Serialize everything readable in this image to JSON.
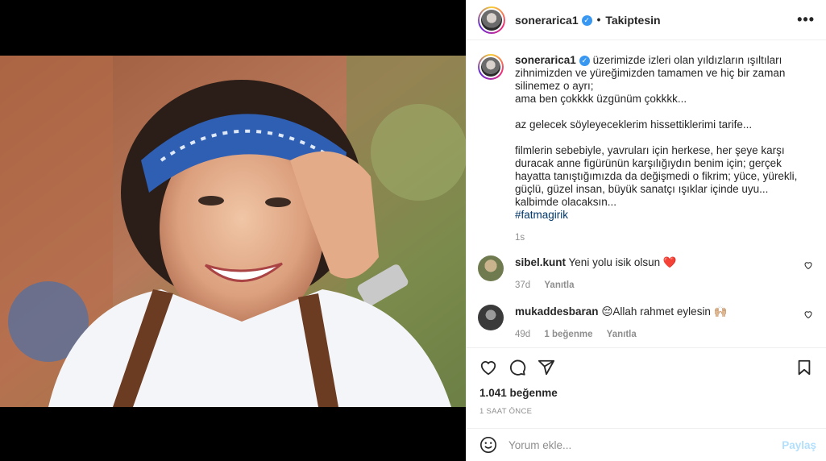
{
  "post": {
    "username": "sonerarica1",
    "follow_status": "Takiptesin",
    "separator": "•",
    "more_icon": "more-horizontal-icon"
  },
  "caption": {
    "username": "sonerarica1",
    "text": "üzerimizde izleri olan yıldızların ışıltıları zihnimizden ve yüreğimizden tamamen ve hiç bir zaman silinemez o ayrı;\nama ben çokkkk üzgünüm çokkkk...\n\naz gelecek söyleyeceklerim hissettiklerimi tarife...\n\nfilmlerin sebebiyle, yavruları için herkese, her şeye karşı duracak anne figürünün karşılığıydın benim için; gerçek hayatta tanıştığımızda da değişmedi o fikrim; yüce, yürekli, güçlü, güzel insan, büyük sanatçı ışıklar içinde uyu... kalbimde olacaksın...",
    "hashtag": "#fatmagirik",
    "age": "1s"
  },
  "comments": [
    {
      "username": "sibel.kunt",
      "text": "Yeni yolu isik olsun ❤️",
      "age": "37d",
      "likes": "",
      "reply_label": "Yanıtla",
      "avatar_color": "#6f7a4f"
    },
    {
      "username": "mukaddesbaran",
      "text": "😔Allah rahmet eylesin 🙌🏼",
      "age": "49d",
      "likes": "1 beğenme",
      "reply_label": "Yanıtla",
      "avatar_color": "#3a3a3a"
    }
  ],
  "actions": {
    "like_icon": "heart-icon",
    "comment_icon": "comment-icon",
    "share_icon": "share-icon",
    "save_icon": "bookmark-icon",
    "likes_count": "1.041 beğenme",
    "timestamp": "1 SAAT ÖNCE"
  },
  "add_comment": {
    "placeholder": "Yorum ekle...",
    "post_label": "Paylaş",
    "emoji_icon": "emoji-icon"
  },
  "colors": {
    "verified": "#3897f0",
    "link": "#00376b",
    "post_disabled": "#b2dffc",
    "heart_red": "#ed4956"
  }
}
